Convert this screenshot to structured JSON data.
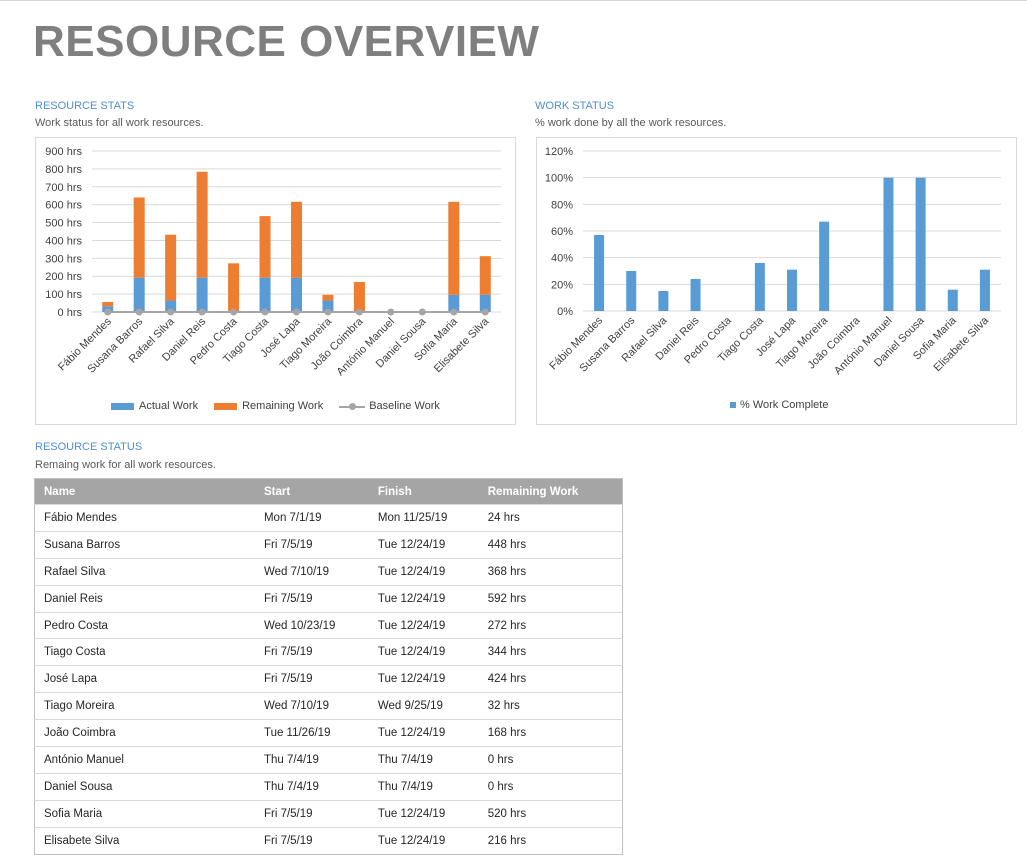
{
  "page": {
    "title": "RESOURCE OVERVIEW"
  },
  "colors": {
    "actual": "#5b9bd5",
    "remaining": "#ed7d31",
    "baseline": "#a5a5a5",
    "section_title": "#4f8fce",
    "table_header": "#a5a5a5"
  },
  "resource_stats": {
    "title": "RESOURCE STATS",
    "subtitle": "Work status for all work resources."
  },
  "work_status": {
    "title": "WORK STATUS",
    "subtitle": "% work done by all the work resources."
  },
  "resource_status": {
    "title": "RESOURCE STATUS",
    "subtitle": "Remaing work for all work resources.",
    "columns": [
      "Name",
      "Start",
      "Finish",
      "Remaining Work"
    ],
    "rows": [
      [
        "Fábio Mendes",
        "Mon 7/1/19",
        "Mon 11/25/19",
        "24 hrs"
      ],
      [
        "Susana Barros",
        "Fri 7/5/19",
        "Tue 12/24/19",
        "448 hrs"
      ],
      [
        "Rafael Silva",
        "Wed 7/10/19",
        "Tue 12/24/19",
        "368 hrs"
      ],
      [
        "Daniel Reis",
        "Fri 7/5/19",
        "Tue 12/24/19",
        "592 hrs"
      ],
      [
        "Pedro Costa",
        "Wed 10/23/19",
        "Tue 12/24/19",
        "272 hrs"
      ],
      [
        "Tiago Costa",
        "Fri 7/5/19",
        "Tue 12/24/19",
        "344 hrs"
      ],
      [
        "José Lapa",
        "Fri 7/5/19",
        "Tue 12/24/19",
        "424 hrs"
      ],
      [
        "Tiago Moreira",
        "Wed 7/10/19",
        "Wed 9/25/19",
        "32 hrs"
      ],
      [
        "João Coimbra",
        "Tue 11/26/19",
        "Tue 12/24/19",
        "168 hrs"
      ],
      [
        "António Manuel",
        "Thu 7/4/19",
        "Thu 7/4/19",
        "0 hrs"
      ],
      [
        "Daniel Sousa",
        "Thu 7/4/19",
        "Thu 7/4/19",
        "0 hrs"
      ],
      [
        "Sofia Maria",
        "Fri 7/5/19",
        "Tue 12/24/19",
        "520 hrs"
      ],
      [
        "Elisabete Silva",
        "Fri 7/5/19",
        "Tue 12/24/19",
        "216 hrs"
      ]
    ]
  },
  "chart_data": [
    {
      "type": "bar",
      "stacked": true,
      "categories": [
        "Fábio Mendes",
        "Susana Barros",
        "Rafael Silva",
        "Daniel Reis",
        "Pedro Costa",
        "Tiago Costa",
        "José Lapa",
        "Tiago Moreira",
        "João Coimbra",
        "António Manuel",
        "Daniel Sousa",
        "Sofia Maria",
        "Elisabete Silva"
      ],
      "series": [
        {
          "name": "Actual Work",
          "values": [
            32,
            192,
            64,
            192,
            0,
            192,
            192,
            64,
            0,
            0,
            0,
            96,
            96
          ]
        },
        {
          "name": "Remaining Work",
          "values": [
            24,
            448,
            368,
            592,
            272,
            344,
            424,
            32,
            168,
            0,
            0,
            520,
            216
          ]
        },
        {
          "name": "Baseline Work",
          "type": "line",
          "values": [
            0,
            0,
            0,
            0,
            0,
            0,
            0,
            0,
            0,
            0,
            0,
            0,
            0
          ]
        }
      ],
      "ylim": [
        0,
        900
      ],
      "yticks": [
        "0 hrs",
        "100 hrs",
        "200 hrs",
        "300 hrs",
        "400 hrs",
        "500 hrs",
        "600 hrs",
        "700 hrs",
        "800 hrs",
        "900 hrs"
      ],
      "grid": true,
      "legend": "bottom"
    },
    {
      "type": "bar",
      "categories": [
        "Fábio Mendes",
        "Susana Barros",
        "Rafael Silva",
        "Daniel Reis",
        "Pedro Costa",
        "Tiago Costa",
        "José Lapa",
        "Tiago Moreira",
        "João Coimbra",
        "António Manuel",
        "Daniel Sousa",
        "Sofia Maria",
        "Elisabete Silva"
      ],
      "series": [
        {
          "name": "% Work Complete",
          "values": [
            57,
            30,
            15,
            24,
            0,
            36,
            31,
            67,
            0,
            100,
            100,
            16,
            31
          ]
        }
      ],
      "ylim": [
        0,
        120
      ],
      "yticks": [
        "0%",
        "20%",
        "40%",
        "60%",
        "80%",
        "100%",
        "120%"
      ],
      "grid": true,
      "legend": "bottom"
    }
  ]
}
